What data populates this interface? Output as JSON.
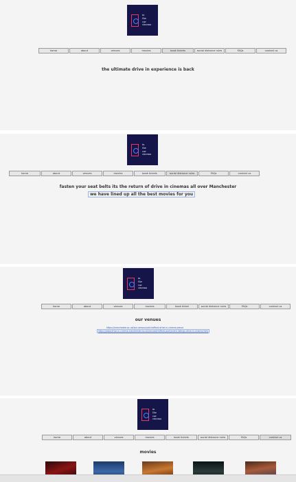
{
  "logo_text": [
    "in",
    "the",
    "car",
    "cinema"
  ],
  "pages": [
    {
      "nav": [
        "home",
        "about",
        "venues",
        "movies",
        "book tickets",
        "social distance rules",
        "FAQs",
        "contact us"
      ],
      "heading": "the ultimate drive in experience is back"
    },
    {
      "nav": [
        "home",
        "about",
        "venues",
        "movies",
        "book tickets",
        "social distance rules",
        "FAQs",
        "contact us"
      ],
      "heading": "fasten your seat belts its the return of drive in cinemas all over Manchester",
      "subheading": "we have lined up all the best movies for you"
    },
    {
      "nav": [
        "home",
        "about",
        "venues",
        "movies",
        "book ticket",
        "social distance rules",
        "FAQs",
        "contact us"
      ],
      "heading": "our venues",
      "links": [
        "https://manchester.ac.uk/our-campus/old-trafford-drive-in-cinema-venue",
        "https://www.drive-in-cinema-manchester.co.uk/venues/trafford-park/event-listings-drive-in-cinema.html"
      ]
    },
    {
      "nav": [
        "home",
        "about",
        "venues",
        "movies",
        "book tickets",
        "social distance rules",
        "FAQs",
        "contact us"
      ],
      "heading": "movies",
      "posters": [
        "movie-poster-1",
        "movie-poster-2",
        "movie-poster-3",
        "movie-poster-4",
        "movie-poster-5"
      ]
    }
  ]
}
